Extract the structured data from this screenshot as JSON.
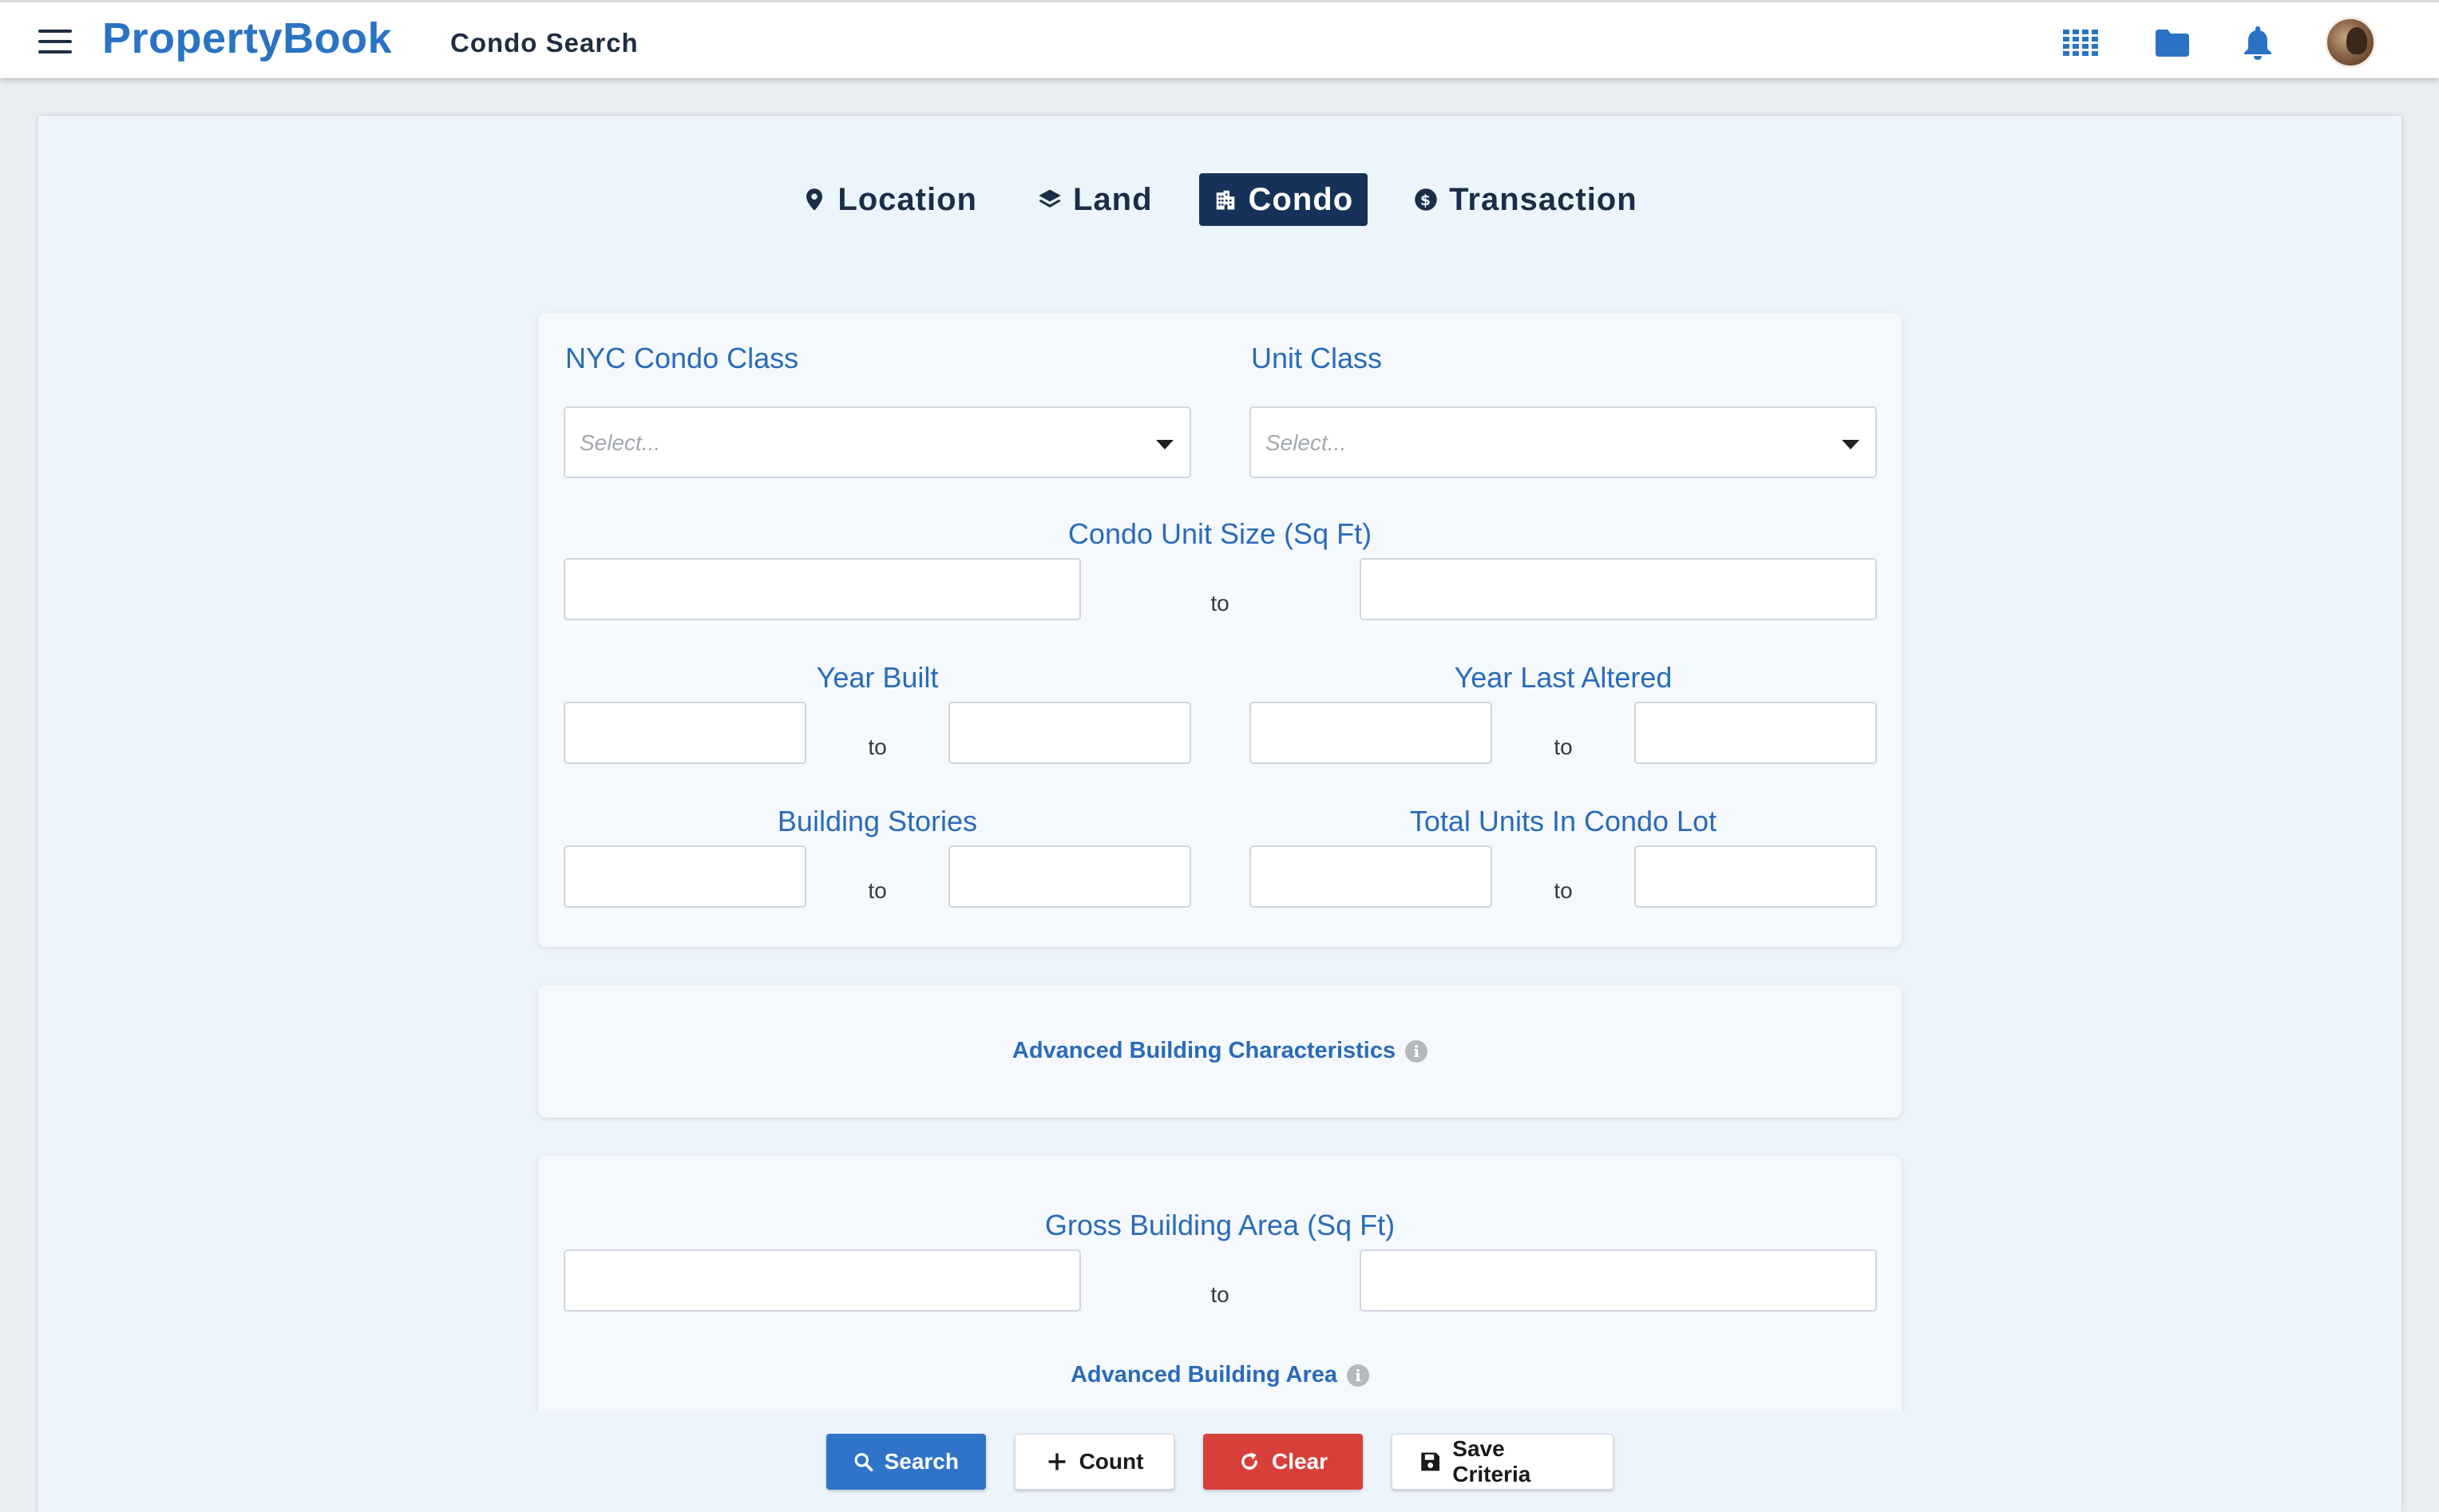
{
  "header": {
    "brand": "PropertyBook",
    "page_title": "Condo Search",
    "icons": [
      "apps-grid-icon",
      "folder-icon",
      "bell-icon",
      "avatar"
    ]
  },
  "tabs": [
    {
      "label": "Location",
      "icon": "map-pin-icon",
      "active": false
    },
    {
      "label": "Land",
      "icon": "layers-icon",
      "active": false
    },
    {
      "label": "Condo",
      "icon": "building-icon",
      "active": true
    },
    {
      "label": "Transaction",
      "icon": "dollar-circle-icon",
      "active": false
    }
  ],
  "condo_form": {
    "nyc_condo_class": {
      "label": "NYC Condo Class",
      "placeholder": "Select..."
    },
    "unit_class": {
      "label": "Unit Class",
      "placeholder": "Select..."
    },
    "condo_unit_size": {
      "label": "Condo Unit Size (Sq Ft)",
      "to": "to"
    },
    "year_built": {
      "label": "Year Built",
      "to": "to"
    },
    "year_last_altered": {
      "label": "Year Last Altered",
      "to": "to"
    },
    "building_stories": {
      "label": "Building Stories",
      "to": "to"
    },
    "total_units": {
      "label": "Total Units In Condo Lot",
      "to": "to"
    }
  },
  "advanced_characteristics": {
    "label": "Advanced Building Characteristics"
  },
  "area_form": {
    "gross_building_area": {
      "label": "Gross Building Area (Sq Ft)",
      "to": "to"
    },
    "advanced_area": {
      "label": "Advanced Building Area"
    }
  },
  "actions": {
    "search": "Search",
    "count": "Count",
    "clear": "Clear",
    "save": "Save Criteria"
  },
  "colors": {
    "brand": "#2a73c4",
    "active_tab": "#163258",
    "label_blue": "#2a6bb8",
    "search_button": "#2f74c8",
    "clear_button": "#d7403a"
  }
}
